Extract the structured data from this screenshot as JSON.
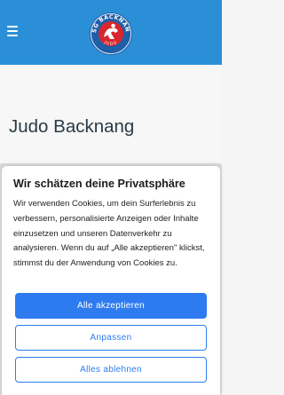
{
  "header": {
    "logo": {
      "text_top": "TSG BACKNANG",
      "text_bottom": "JUDO"
    },
    "colors": {
      "background": "#2a8fd6",
      "logo_ring": "#1f5fa8",
      "logo_red": "#d8262d"
    },
    "menu_icon": "hamburger-icon"
  },
  "main": {
    "page_title": "Judo Backnang"
  },
  "cookie_banner": {
    "title": "Wir schätzen deine Privatsphäre",
    "text": "Wir verwenden Cookies, um dein Surferlebnis zu verbessern, personalisierte Anzeigen oder Inhalte einzusetzen und unseren Datenverkehr zu analysieren. Wenn du auf „Alle akzeptieren\" klickst, stimmst du der Anwendung von Cookies zu.",
    "accept_label": "Alle akzeptieren",
    "customize_label": "Anpassen",
    "reject_label": "Alles ablehnen",
    "accent_color": "#2e7bf0"
  }
}
